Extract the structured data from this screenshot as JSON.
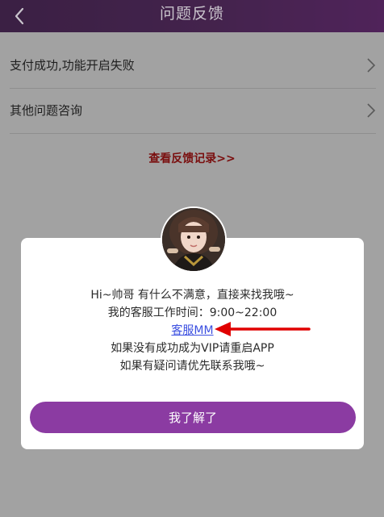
{
  "header": {
    "title": "问题反馈",
    "back_icon": "chevron-left-icon"
  },
  "menu": {
    "items": [
      {
        "label": "支付成功,功能开启失败",
        "icon": "chevron-right-icon"
      },
      {
        "label": "其他问题咨询",
        "icon": "chevron-right-icon"
      }
    ],
    "history_link": "查看反馈记录>>"
  },
  "dialog": {
    "line1": "Hi~帅哥 有什么不满意，直接来找我哦~",
    "line2": "我的客服工作时间：9:00~22:00",
    "service_link": "客服MM",
    "line3": "如果没有成功成为VIP请重启APP",
    "line4": "如果有疑问请优先联系我哦~",
    "confirm_button": "我了解了",
    "annotation": "red-arrow-icon"
  },
  "colors": {
    "header": "#5a2f66",
    "overlay_bg": "#a2a2a2",
    "history_link": "#7a0f0f",
    "service_link": "#3b4fe0",
    "button": "#8b3ba2",
    "arrow": "#e00000"
  }
}
